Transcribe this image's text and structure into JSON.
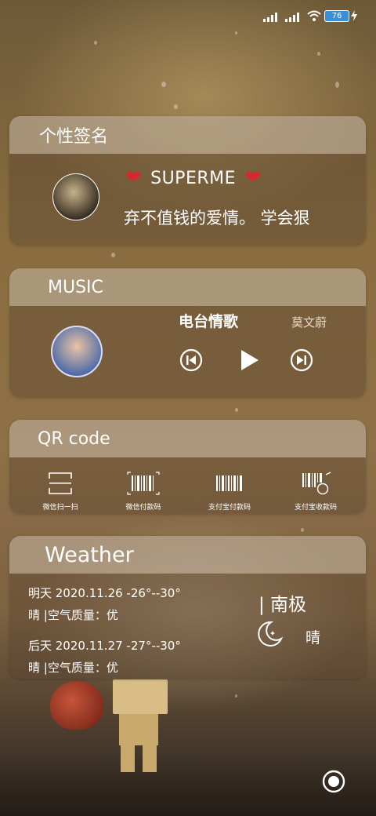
{
  "status_bar": {
    "battery": "76"
  },
  "signature_card": {
    "title": "个性签名",
    "name": "SUPERME",
    "text": "弃不值钱的爱情。  学会狠"
  },
  "music_card": {
    "title": "MUSIC",
    "song": "电台情歌",
    "artist": "莫文蔚"
  },
  "qr_card": {
    "title": "QR code",
    "items": [
      {
        "label": "微信扫一扫",
        "icon": "scan-frame-icon"
      },
      {
        "label": "微信付款码",
        "icon": "barcode-icon"
      },
      {
        "label": "支付宝付款码",
        "icon": "barcode-icon"
      },
      {
        "label": "支付宝收款码",
        "icon": "barcode-coin-icon"
      }
    ]
  },
  "weather_card": {
    "title": "Weather",
    "day1": "明天 2020.11.26  -26°--30°",
    "day1_detail": "晴 |空气质量：优",
    "day2": "后天 2020.11.27  -27°--30°",
    "day2_detail": "晴 |空气质量：优",
    "location": "| 南极",
    "condition": "晴"
  }
}
